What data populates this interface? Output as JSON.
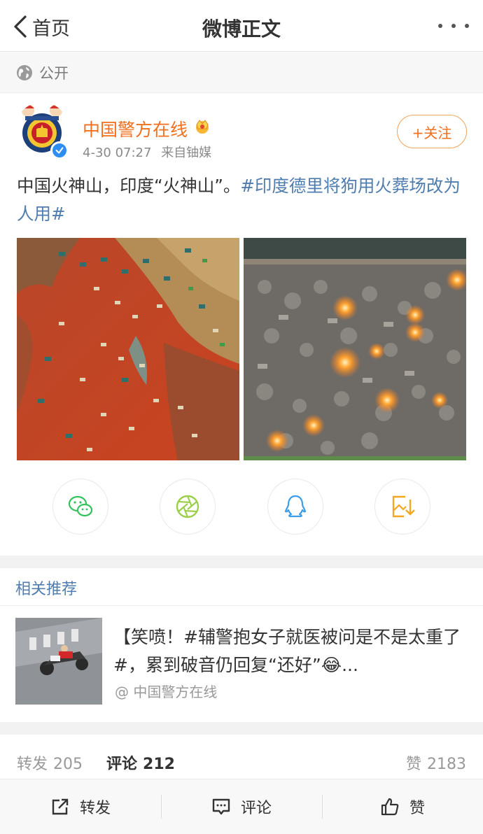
{
  "nav": {
    "back_label": "首页",
    "title": "微博正文"
  },
  "visibility": {
    "label": "公开"
  },
  "post": {
    "author": "中国警方在线",
    "time": "4-30 07:27",
    "source": "来自铀媒",
    "follow_label": "+关注",
    "text_plain": "中国火神山，印度“火神山”。",
    "text_tag": "#印度德里将狗用火葬场改为人用#"
  },
  "share": {
    "items": [
      "wechat-icon",
      "moments-icon",
      "qq-icon",
      "save-image-icon"
    ],
    "colors": {
      "wechat": "#34c25c",
      "moments": "#9cd04b",
      "qq": "#3a9ee8",
      "save": "#f5a623"
    }
  },
  "related": {
    "title": "相关推荐",
    "item": {
      "text": "【笑喷！#辅警抱女子就医被问是不是太重了#，累到破音仍回复“还好”😂...",
      "source": "@ 中国警方在线"
    }
  },
  "counts": {
    "repost_label": "转发",
    "repost_value": "205",
    "comment_label": "评论",
    "comment_value": "212",
    "like_label": "赞",
    "like_value": "2183"
  },
  "bottom_bar": {
    "repost_label": "转发",
    "comment_label": "评论",
    "like_label": "赞"
  },
  "colors": {
    "accent_orange": "#f26f1d",
    "link_blue": "#507daf",
    "verified_blue": "#2d8df3"
  }
}
